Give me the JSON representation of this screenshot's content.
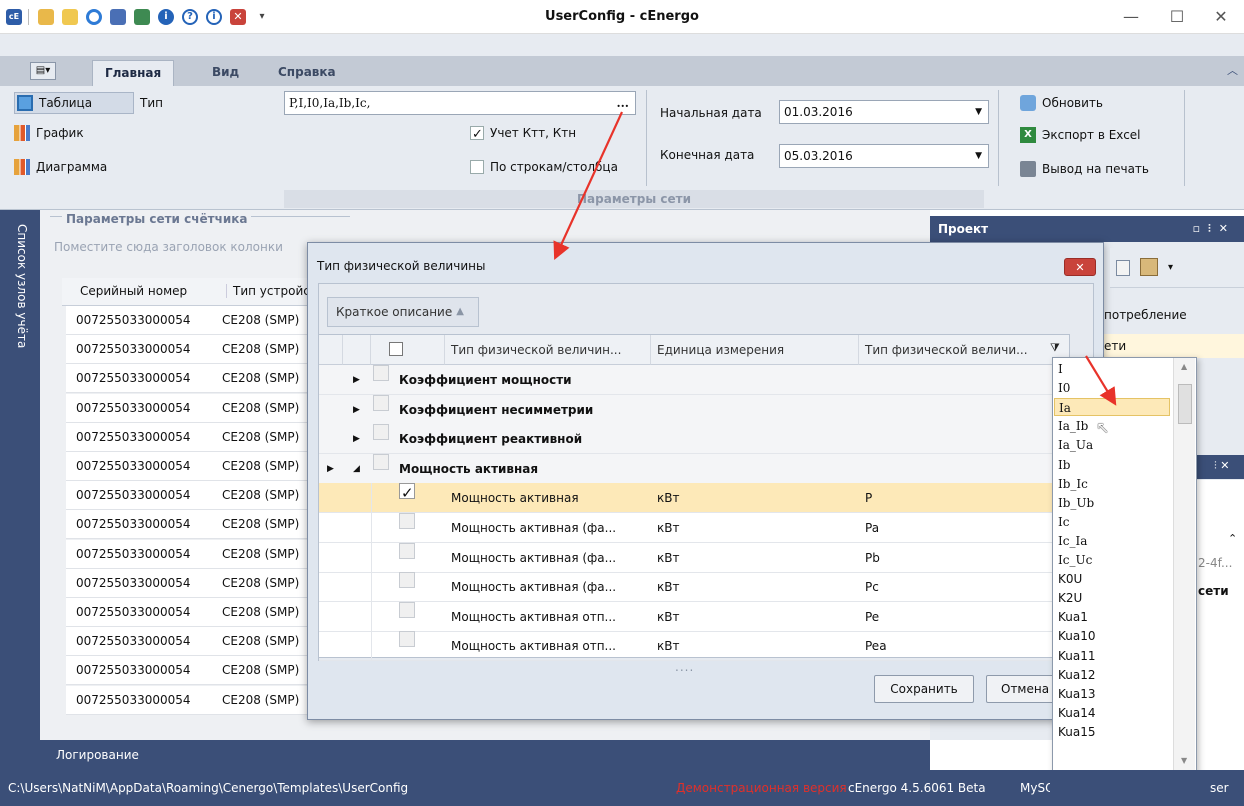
{
  "window": {
    "title": "UserConfig - cEnergo",
    "minimize": "—",
    "maximize": "☐",
    "close": "✕"
  },
  "ribbon": {
    "tabs": [
      "Главная",
      "Вид",
      "Справка"
    ],
    "view_buttons": [
      "Таблица",
      "График",
      "Диаграмма"
    ],
    "type_label": "Тип",
    "type_value": "P,I,I0,Ia,Ib,Ic,",
    "type_more": "...",
    "check_ktt": "Учет Ктт, Ктн",
    "check_rows": "По строкам/столбца",
    "start_date_label": "Начальная дата",
    "start_date": "01.03.2016",
    "end_date_label": "Конечная дата",
    "end_date": "05.03.2016",
    "refresh": "Обновить",
    "export": "Экспорт в Excel",
    "print": "Вывод на печать",
    "group_label": "Параметры сети"
  },
  "sidebar": {
    "tab_label": "Список узлов учёта"
  },
  "main_panel": {
    "group_title": "Параметры сети счётчика",
    "group_hint": "Поместите сюда заголовок колонки",
    "col_serial": "Серийный номер",
    "col_device": "Тип устройства",
    "rows": [
      {
        "serial": "007255033000054",
        "device": "CE208 (SMP)"
      },
      {
        "serial": "007255033000054",
        "device": "CE208 (SMP)"
      },
      {
        "serial": "007255033000054",
        "device": "CE208 (SMP)"
      },
      {
        "serial": "007255033000054",
        "device": "CE208 (SMP)"
      },
      {
        "serial": "007255033000054",
        "device": "CE208 (SMP)"
      },
      {
        "serial": "007255033000054",
        "device": "CE208 (SMP)"
      },
      {
        "serial": "007255033000054",
        "device": "CE208 (SMP)"
      },
      {
        "serial": "007255033000054",
        "device": "CE208 (SMP)"
      },
      {
        "serial": "007255033000054",
        "device": "CE208 (SMP)"
      },
      {
        "serial": "007255033000054",
        "device": "CE208 (SMP)"
      },
      {
        "serial": "007255033000054",
        "device": "CE208 (SMP)"
      },
      {
        "serial": "007255033000054",
        "device": "CE208 (SMP)"
      },
      {
        "serial": "007255033000054",
        "device": "CE208 (SMP)"
      },
      {
        "serial": "007255033000054",
        "device": "CE208 (SMP)"
      }
    ]
  },
  "project_panel": {
    "title": "Проект",
    "item1": "потребление",
    "item2": "ети",
    "partial1": "2-4f...",
    "partial2": "сети",
    "partial3": "ser"
  },
  "dialog": {
    "title": "Тип физической величины",
    "close": "✕",
    "group_by": "Краткое описание",
    "columns": [
      "Тип физической величин...",
      "Единица измерения",
      "Тип физической величи..."
    ],
    "groups": [
      "Коэффициент мощности",
      "Коэффициент несимметрии",
      "Коэффициент реактивной",
      "Мощность активная"
    ],
    "rows": [
      {
        "name": "Мощность активная",
        "unit": "кВт",
        "code": "P",
        "checked": true
      },
      {
        "name": "Мощность активная (фа...",
        "unit": "кВт",
        "code": "Pa",
        "checked": false
      },
      {
        "name": "Мощность активная (фа...",
        "unit": "кВт",
        "code": "Pb",
        "checked": false
      },
      {
        "name": "Мощность активная (фа...",
        "unit": "кВт",
        "code": "Pc",
        "checked": false
      },
      {
        "name": "Мощность активная отп...",
        "unit": "кВт",
        "code": "Pe",
        "checked": false
      },
      {
        "name": "Мощность активная отп...",
        "unit": "кВт",
        "code": "Pea",
        "checked": false
      }
    ],
    "save": "Сохранить",
    "cancel": "Отмена",
    "resize_dots": "...."
  },
  "filter_list": {
    "items": [
      "I",
      "I0",
      "Ia",
      "Ia_Ib",
      "Ia_Ua",
      "Ib",
      "Ib_Ic",
      "Ib_Ub",
      "Ic",
      "Ic_Ia",
      "Ic_Uc",
      "K0U",
      "K2U",
      "Kua1",
      "Kua10",
      "Kua11",
      "Kua12",
      "Kua13",
      "Kua14",
      "Kua15"
    ],
    "highlighted": "Ia"
  },
  "bottom": {
    "log_label": "Логирование",
    "path": "C:\\Users\\NatNiM\\AppData\\Roaming\\Cenergo\\Templates\\UserConfig",
    "demo": "Демонстрационная версия",
    "version": "cEnergo 4.5.6061 Beta",
    "db": "MySQL"
  },
  "colors": {
    "accent": "#3b4f78",
    "ribbon": "#e7ebf1",
    "selection": "#fde9b8",
    "demo_text": "#e0302a",
    "annotation_arrow": "#e8332a"
  }
}
